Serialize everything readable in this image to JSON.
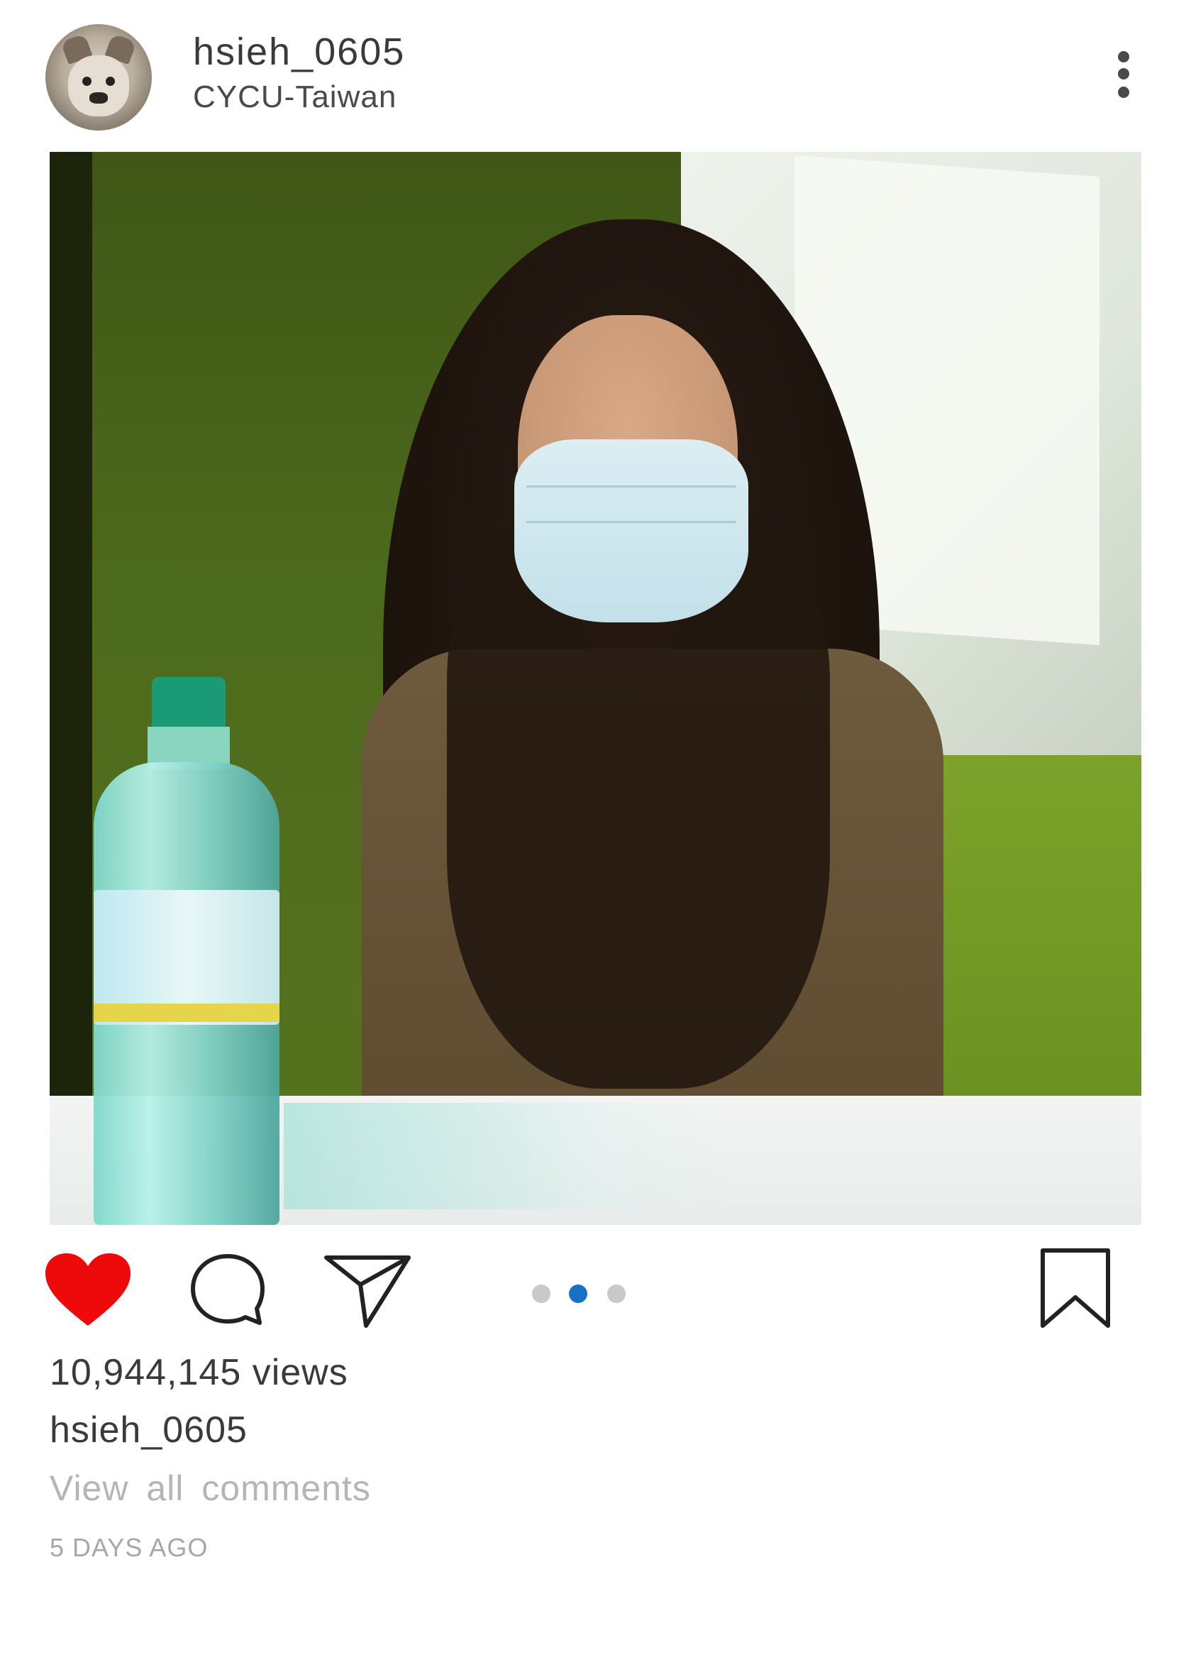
{
  "header": {
    "username": "hsieh_0605",
    "location": "CYCU-Taiwan",
    "avatar_icon": "french-bulldog-avatar",
    "more_icon": "more-vertical-icon"
  },
  "post": {
    "photo_description_icon": "photo"
  },
  "actions": {
    "like_icon": "heart-filled-icon",
    "like_color": "#ee0a0a",
    "comment_icon": "comment-icon",
    "share_icon": "send-icon",
    "save_icon": "bookmark-icon",
    "carousel": {
      "count": 3,
      "active_index": 1,
      "active_color": "#1673c4",
      "inactive_color": "#c9c9c9"
    }
  },
  "stats": {
    "views": "10,944,145 views",
    "caption_username": "hsieh_0605",
    "view_comments": "View all  comments",
    "timestamp": "5 DAYS AGO"
  }
}
